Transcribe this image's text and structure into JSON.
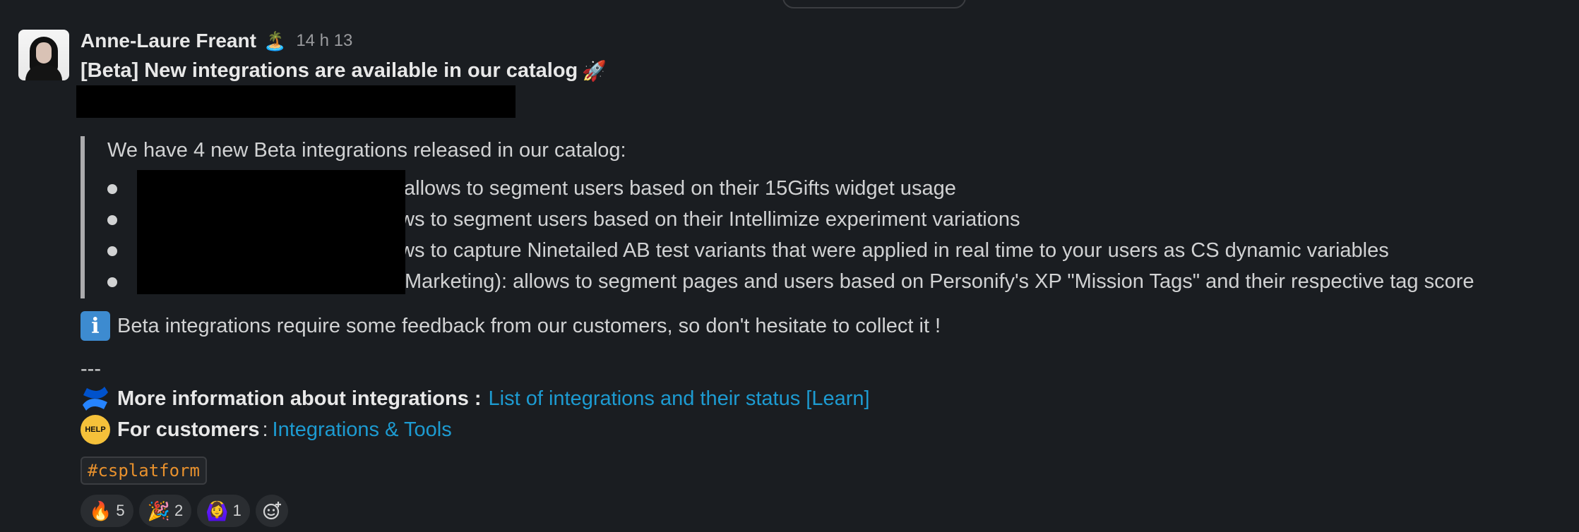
{
  "message": {
    "author": "Anne-Laure Freant",
    "status_emoji": "🏝️",
    "time": "14 h 13",
    "title": "[Beta] New integrations are available in our catalog",
    "title_emoji": "🚀",
    "quote": {
      "intro": "We have 4 new Beta integrations released in our catalog:",
      "bullets": [
        {
          "text": "allows to segment users based on their 15Gifts widget usage"
        },
        {
          "text": "ws to segment users based on their Intellimize experiment variations"
        },
        {
          "text": "ws to capture Ninetailed AB test variants that were applied in real time to your users as CS dynamic variables"
        },
        {
          "text": "Marketing): allows to segment pages and users based on Personify's XP \"Mission Tags\" and their respective tag score"
        }
      ]
    },
    "info": {
      "icon": "information-icon",
      "text": "Beta integrations require some feedback from our customers, so don't hesitate to collect it !"
    },
    "divider": "---",
    "links": [
      {
        "icon": "confluence-icon",
        "label": "More information about integrations :",
        "link_text": "List of integrations and their status [Learn]"
      },
      {
        "icon": "help-face-icon",
        "label": "For customers",
        "separator": ":",
        "link_text": "Integrations & Tools"
      }
    ],
    "channel_tag": "#csplatform",
    "reactions": [
      {
        "emoji": "🔥",
        "count": "5"
      },
      {
        "emoji": "🎉",
        "count": "2"
      },
      {
        "emoji": "🙆‍♀️",
        "count": "1"
      }
    ]
  },
  "colors": {
    "background": "#1a1d21",
    "text": "#d1d2d3",
    "link": "#1d9bd1",
    "tag": "#e8912d",
    "reaction_bg": "#2a2d31"
  }
}
